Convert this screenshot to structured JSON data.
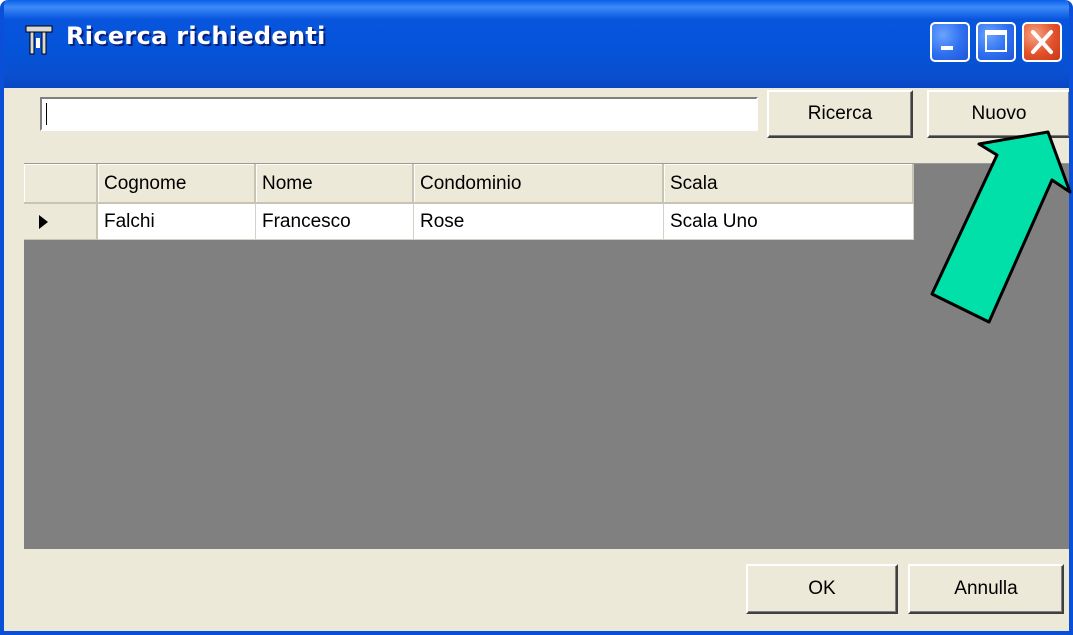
{
  "window": {
    "title": "Ricerca richiedenti"
  },
  "search": {
    "value": "",
    "placeholder": "",
    "search_label": "Ricerca",
    "new_label": "Nuovo"
  },
  "grid": {
    "columns": [
      "Cognome",
      "Nome",
      "Condominio",
      "Scala"
    ],
    "rows": [
      {
        "cognome": "Falchi",
        "nome": "Francesco",
        "condominio": "Rose",
        "scala": "Scala Uno"
      }
    ]
  },
  "footer": {
    "ok_label": "OK",
    "cancel_label": "Annulla"
  },
  "annotation": {
    "arrow_color": "#00e0a8",
    "icon": "pointer-arrow-icon"
  },
  "theme": {
    "titlebar_color": "#0a4fd8",
    "client_color": "#ece9d8",
    "grid_background": "#808080"
  }
}
